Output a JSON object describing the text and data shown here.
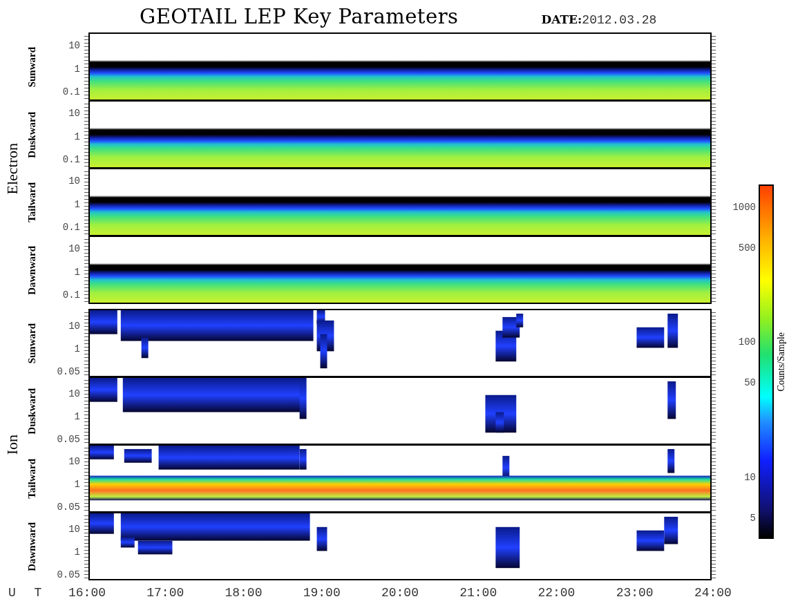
{
  "title": "GEOTAIL LEP Key Parameters",
  "date_label": "DATE:",
  "date": "2012.03.28",
  "groups": [
    {
      "name": "Electron",
      "kind": "electron",
      "panels": [
        {
          "direction": "Sunward",
          "y_ticks": [
            "10",
            "1",
            "0.1"
          ]
        },
        {
          "direction": "Duskward",
          "y_ticks": [
            "10",
            "1",
            "0.1"
          ]
        },
        {
          "direction": "Tailward",
          "y_ticks": [
            "10",
            "1",
            "0.1"
          ]
        },
        {
          "direction": "Dawnward",
          "y_ticks": [
            "10",
            "1",
            "0.1"
          ]
        }
      ]
    },
    {
      "name": "Ion",
      "kind": "ion",
      "panels": [
        {
          "direction": "Sunward",
          "y_ticks": [
            "10",
            "1",
            "0.05"
          ]
        },
        {
          "direction": "Duskward",
          "y_ticks": [
            "10",
            "1",
            "0.05"
          ]
        },
        {
          "direction": "Tailward",
          "y_ticks": [
            "10",
            "1",
            "0.05"
          ]
        },
        {
          "direction": "Dawnward",
          "y_ticks": [
            "10",
            "1",
            "0.05"
          ]
        }
      ]
    }
  ],
  "colorbar": {
    "title": "Counts/Sample",
    "ticks": [
      "1000",
      "500",
      "100",
      "50",
      "10",
      "5"
    ]
  },
  "time_axis": {
    "label": "U T",
    "ticks": [
      "16:00",
      "17:00",
      "18:00",
      "19:00",
      "20:00",
      "21:00",
      "22:00",
      "23:00",
      "24:00"
    ]
  }
}
